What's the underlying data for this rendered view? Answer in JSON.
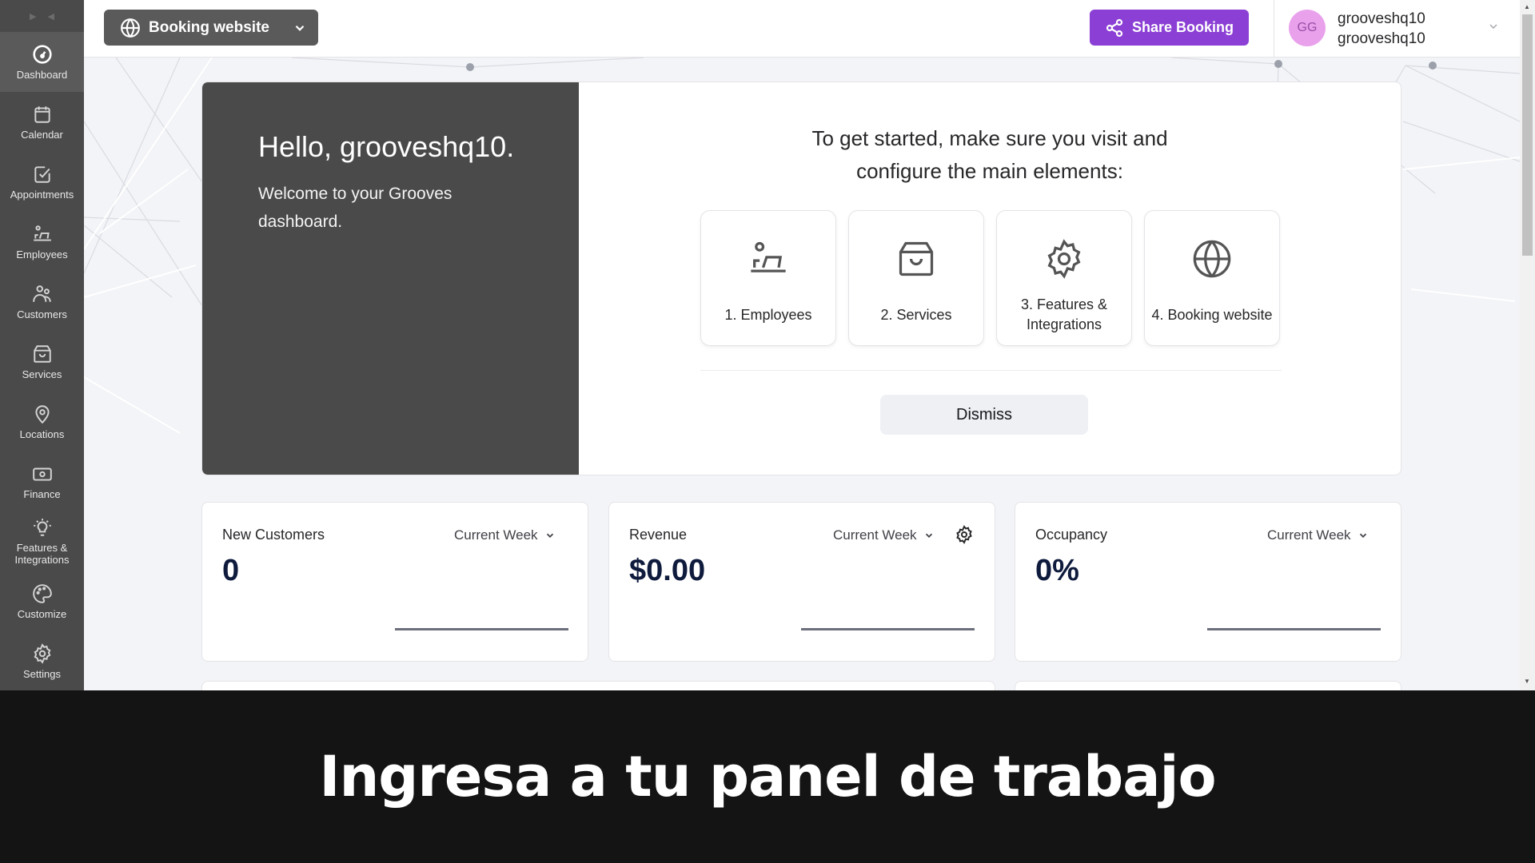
{
  "topbar": {
    "site_selector": "Booking website",
    "share_button": "Share Booking",
    "user": {
      "initials": "GG",
      "name_line1": "grooveshq10",
      "name_line2": "grooveshq10"
    }
  },
  "sidebar": {
    "items": [
      {
        "label": "Dashboard",
        "icon": "gauge-icon",
        "active": true
      },
      {
        "label": "Calendar",
        "icon": "calendar-icon"
      },
      {
        "label": "Appointments",
        "icon": "checkbox-icon"
      },
      {
        "label": "Employees",
        "icon": "employee-laptop-icon"
      },
      {
        "label": "Customers",
        "icon": "users-icon"
      },
      {
        "label": "Services",
        "icon": "shopping-bag-icon"
      },
      {
        "label": "Locations",
        "icon": "map-pin-icon"
      },
      {
        "label": "Finance",
        "icon": "banknote-icon"
      },
      {
        "label": "Features & Integrations",
        "icon": "lightbulb-icon"
      },
      {
        "label": "Customize",
        "icon": "palette-icon"
      },
      {
        "label": "Settings",
        "icon": "gear-icon"
      }
    ]
  },
  "welcome": {
    "greeting": "Hello, grooveshq10.",
    "subtitle": "Welcome to your Grooves dashboard.",
    "intro": "To get started, make sure you visit and configure the main elements:",
    "steps": [
      {
        "label": "1. Employees",
        "icon": "employee-laptop-icon"
      },
      {
        "label": "2. Services",
        "icon": "shopping-bag-icon"
      },
      {
        "label": "3. Features & Integrations",
        "icon": "gear-icon"
      },
      {
        "label": "4. Booking website",
        "icon": "globe-icon"
      }
    ],
    "dismiss": "Dismiss"
  },
  "stats": [
    {
      "title": "New Customers",
      "period": "Current Week",
      "value": "0"
    },
    {
      "title": "Revenue",
      "period": "Current Week",
      "value": "$0.00"
    },
    {
      "title": "Occupancy",
      "period": "Current Week",
      "value": "0%"
    }
  ],
  "caption": "Ingresa a tu panel de trabajo",
  "colors": {
    "sidebar": "#4a4a4a",
    "accent": "#8b3fd4",
    "avatar": "#e9a1ec"
  }
}
